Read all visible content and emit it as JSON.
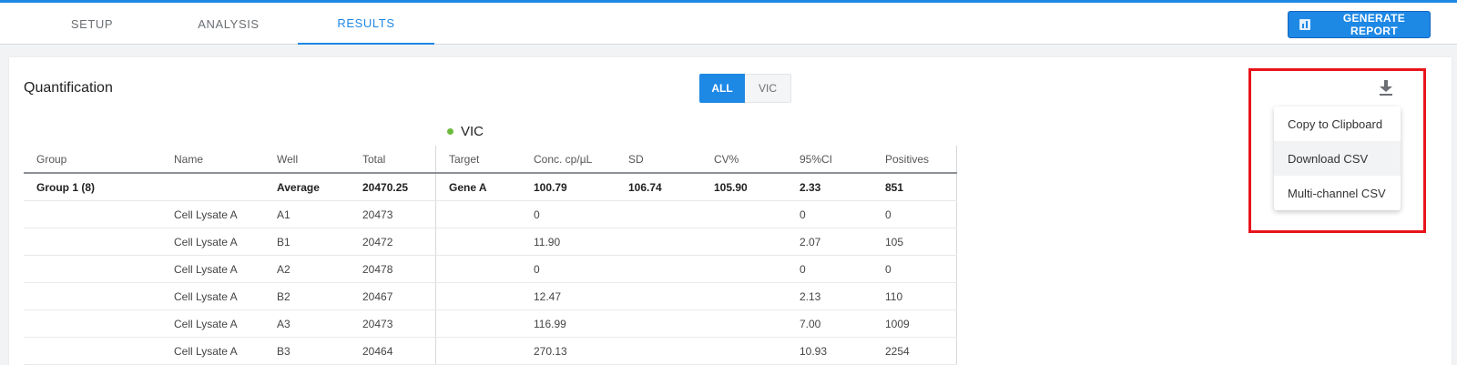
{
  "tabs": [
    {
      "label": "SETUP",
      "active": false
    },
    {
      "label": "ANALYSIS",
      "active": false
    },
    {
      "label": "RESULTS",
      "active": true
    }
  ],
  "header": {
    "generate_report_label": "GENERATE REPORT",
    "generate_report_icon": "bar-chart-icon"
  },
  "panel": {
    "title": "Quantification",
    "filter": {
      "options": [
        "ALL",
        "VIC"
      ],
      "selected": "ALL"
    },
    "channel": {
      "label": "VIC",
      "dot_color": "#6dbb3d"
    }
  },
  "table": {
    "columns": [
      "Group",
      "Name",
      "Well",
      "Total",
      "Target",
      "Conc. cp/µL",
      "SD",
      "CV%",
      "95%CI",
      "Positives"
    ],
    "rows": [
      [
        "Group 1 (8)",
        "",
        "Average",
        "20470.25",
        "Gene A",
        "100.79",
        "106.74",
        "105.90",
        "2.33",
        "851"
      ],
      [
        "",
        "Cell Lysate A",
        "A1",
        "20473",
        "",
        "0",
        "",
        "",
        "0",
        "0"
      ],
      [
        "",
        "Cell Lysate A",
        "B1",
        "20472",
        "",
        "11.90",
        "",
        "",
        "2.07",
        "105"
      ],
      [
        "",
        "Cell Lysate A",
        "A2",
        "20478",
        "",
        "0",
        "",
        "",
        "0",
        "0"
      ],
      [
        "",
        "Cell Lysate A",
        "B2",
        "20467",
        "",
        "12.47",
        "",
        "",
        "2.13",
        "110"
      ],
      [
        "",
        "Cell Lysate A",
        "A3",
        "20473",
        "",
        "116.99",
        "",
        "",
        "7.00",
        "1009"
      ],
      [
        "",
        "Cell Lysate A",
        "B3",
        "20464",
        "",
        "270.13",
        "",
        "",
        "10.93",
        "2254"
      ]
    ]
  },
  "download": {
    "icon": "download-icon",
    "menu": [
      "Copy to Clipboard",
      "Download CSV",
      "Multi-channel CSV"
    ],
    "hovered": "Download CSV"
  },
  "colors": {
    "accent": "#1e88e5",
    "highlight": "#e8141c"
  }
}
